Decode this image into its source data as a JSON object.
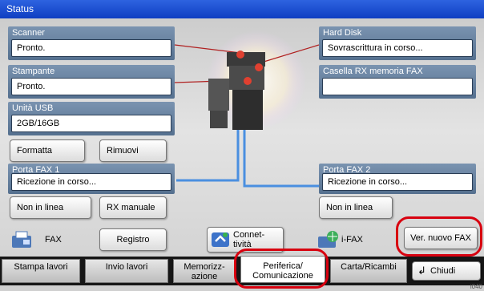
{
  "title": "Status",
  "scanner": {
    "label": "Scanner",
    "value": "Pronto."
  },
  "printer": {
    "label": "Stampante",
    "value": "Pronto."
  },
  "usb": {
    "label": "Unità USB",
    "value": "2GB/16GB",
    "format": "Formatta",
    "remove": "Rimuovi"
  },
  "harddisk": {
    "label": "Hard Disk",
    "value": "Sovrascrittura in corso..."
  },
  "fax_box": {
    "label": "Casella RX memoria FAX",
    "value": ""
  },
  "fax_port1": {
    "label": "Porta FAX 1",
    "value": "Ricezione in corso...",
    "offline": "Non in linea",
    "manual_rx": "RX manuale"
  },
  "fax_port2": {
    "label": "Porta FAX 2",
    "value": "Ricezione in corso...",
    "offline": "Non in linea"
  },
  "bottom": {
    "fax": "FAX",
    "log": "Registro",
    "connectivity": "Connet-\ntività",
    "ifax": "i-FAX",
    "check_new_fax": "Ver. nuovo FAX"
  },
  "tabs": [
    "Stampa lavori",
    "Invio lavori",
    "Memorizz-\nazione",
    "Periferica/\nComunicazione",
    "Carta/Ricambi"
  ],
  "close": "Chiudi",
  "footer_code": "i040",
  "colors": {
    "title": "#1a4fd0",
    "panel": "#6a84a3",
    "callout": "#d8000f",
    "cable": "#4a8fe0"
  }
}
